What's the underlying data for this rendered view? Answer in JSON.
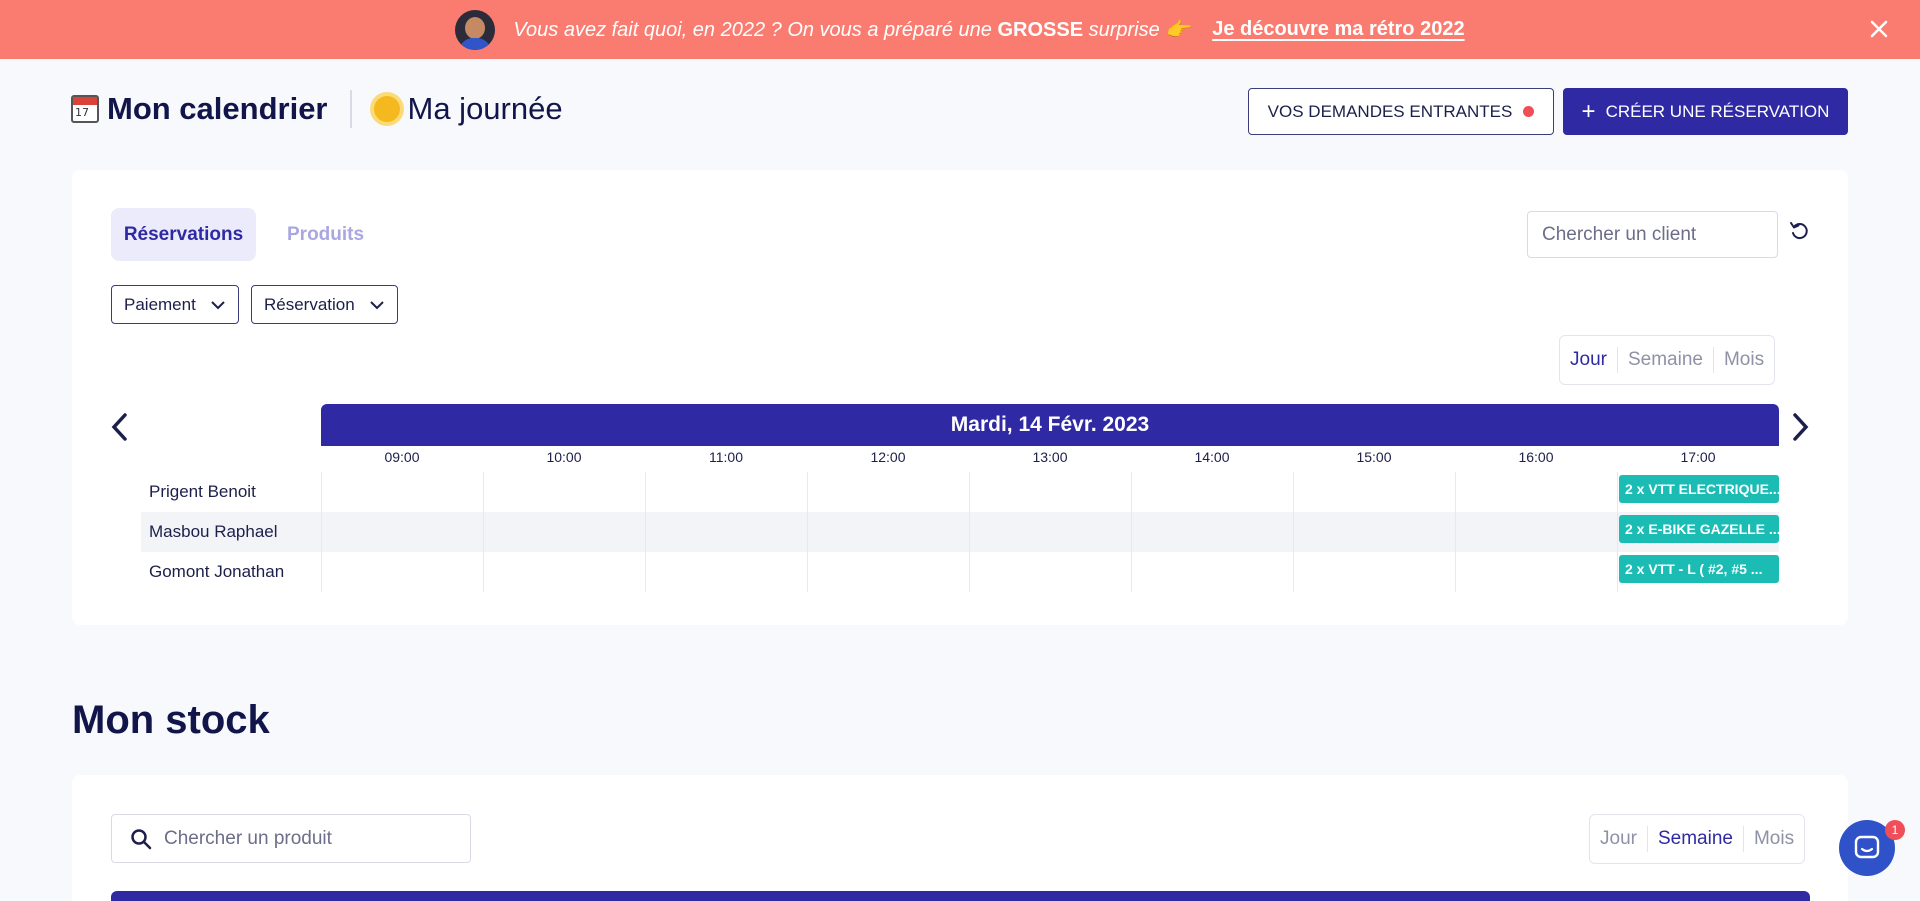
{
  "banner": {
    "message_prefix": "Vous avez fait quoi, en 2022 ? On vous a préparé une ",
    "message_bold": "GROSSE",
    "message_suffix": " surprise 👉",
    "cta": "Je découvre ma rétro 2022"
  },
  "header": {
    "calendar_emoji_day": "17",
    "title": "Mon calendrier",
    "subtitle": "Ma journée",
    "incoming_button": "VOS DEMANDES ENTRANTES",
    "create_button": "CRÉER UNE RÉSERVATION"
  },
  "calendar_card": {
    "tabs": [
      "Réservations",
      "Produits"
    ],
    "search_placeholder": "Chercher un client",
    "filters": [
      "Paiement",
      "Réservation"
    ],
    "views": [
      "Jour",
      "Semaine",
      "Mois"
    ],
    "active_view": "Jour",
    "date": "Mardi, 14 Févr. 2023",
    "hours": [
      "09:00",
      "10:00",
      "11:00",
      "12:00",
      "13:00",
      "14:00",
      "15:00",
      "16:00",
      "17:00"
    ],
    "rows": [
      {
        "name": "Prigent Benoit",
        "event": "2 x VTT ELECTRIQUE..."
      },
      {
        "name": "Masbou Raphael",
        "event": "2 x E-BIKE GAZELLE ..."
      },
      {
        "name": "Gomont Jonathan",
        "event": "2 x VTT - L ( #2, #5 ..."
      }
    ]
  },
  "stock": {
    "title": "Mon stock",
    "search_placeholder": "Chercher un produit",
    "views": [
      "Jour",
      "Semaine",
      "Mois"
    ],
    "active_view": "Semaine"
  },
  "chat": {
    "badge_count": "1"
  },
  "colors": {
    "banner": "#fa7c70",
    "primary": "#2f2aa3",
    "event": "#1bbcb4",
    "alert": "#f04e58"
  }
}
